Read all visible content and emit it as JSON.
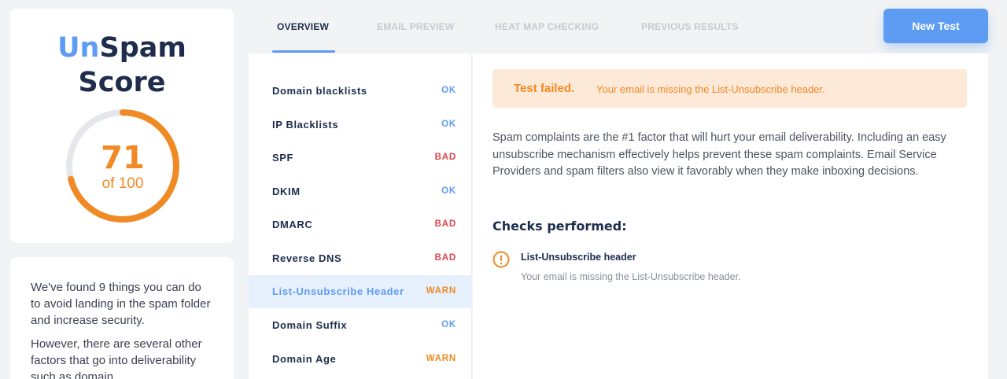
{
  "score": {
    "title_un": "Un",
    "title_spam": "Spam",
    "title_score": "Score",
    "value": 71,
    "value_text": "71",
    "out_of_text": "of 100",
    "max": 100,
    "ring_color": "#f08a24",
    "track_color": "#e5e7eb"
  },
  "info": {
    "paragraph1": "We've found 9 things you can do to avoid landing in the spam folder and increase security.",
    "paragraph2": "However, there are several other factors that go into deliverability such as domain"
  },
  "tabs": [
    {
      "label": "OVERVIEW",
      "active": true
    },
    {
      "label": "EMAIL PREVIEW",
      "active": false
    },
    {
      "label": "HEAT MAP CHECKING",
      "active": false
    },
    {
      "label": "PREVIOUS RESULTS",
      "active": false
    }
  ],
  "new_test_label": "New Test",
  "checks": [
    {
      "name": "Domain blacklists",
      "status": "OK"
    },
    {
      "name": "IP Blacklists",
      "status": "OK"
    },
    {
      "name": "SPF",
      "status": "BAD"
    },
    {
      "name": "DKIM",
      "status": "OK"
    },
    {
      "name": "DMARC",
      "status": "BAD"
    },
    {
      "name": "Reverse DNS",
      "status": "BAD"
    },
    {
      "name": "List-Unsubscribe Header",
      "status": "WARN",
      "selected": true
    },
    {
      "name": "Domain Suffix",
      "status": "OK"
    },
    {
      "name": "Domain Age",
      "status": "WARN"
    }
  ],
  "detail": {
    "alert_strong": "Test failed.",
    "alert_text": "Your email is missing the List-Unsubscribe header.",
    "description": "Spam complaints are the #1 factor that will hurt your email deliverability. Including an easy unsubscribe mechanism effectively helps prevent these spam complaints. Email Service Providers and spam filters also view it favorably when they make inboxing decisions.",
    "checks_title": "Checks performed:",
    "performed": [
      {
        "name": "List-Unsubscribe header",
        "description": "Your email is missing the List-Unsubscribe header.",
        "icon": "warning-icon"
      }
    ]
  },
  "colors": {
    "accent": "#5e9cf3",
    "ok": "#5e9cf3",
    "bad": "#e0434b",
    "warn": "#f08a24",
    "navy": "#1e2d4d"
  }
}
